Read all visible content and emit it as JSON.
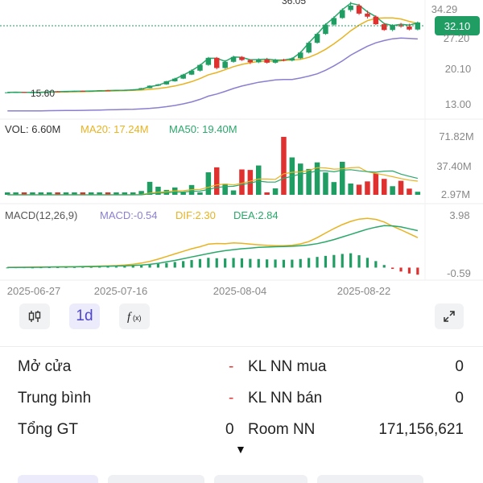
{
  "price_panel": {
    "axis_labels": [
      "34.29",
      "27.20",
      "20.10",
      "13.00"
    ],
    "current_price": "32.10",
    "low_marker": "15.60",
    "high_marker": "36.05",
    "accent_color": "#1f9d63"
  },
  "volume_panel": {
    "legend_vol": "VOL: 6.60M",
    "legend_ma20": "MA20: 17.24M",
    "legend_ma50": "MA50: 19.40M",
    "axis_labels": [
      "71.82M",
      "37.40M",
      "2.97M"
    ]
  },
  "macd_panel": {
    "legend_params": "MACD(12,26,9)",
    "legend_macd": "MACD:-0.54",
    "legend_dif": "DIF:2.30",
    "legend_dea": "DEA:2.84",
    "axis_labels": [
      "3.98",
      "-0.59"
    ]
  },
  "dates": [
    "2025-06-27",
    "2025-07-16",
    "2025-08-04",
    "2025-08-22"
  ],
  "toolbar": {
    "timeframe": "1d"
  },
  "stats": {
    "open_label": "Mở cửa",
    "open_value": "-",
    "avg_label": "Trung bình",
    "avg_value": "-",
    "total_label": "Tổng GT",
    "total_value": "0",
    "buy_label": "KL NN mua",
    "buy_value": "0",
    "sell_label": "KL NN bán",
    "sell_value": "0",
    "room_label": "Room NN",
    "room_value": "171,156,621"
  },
  "colors": {
    "up": "#1f9d63",
    "down": "#e03131",
    "ma20": "#e8b320",
    "ma50": "#2aa86a",
    "ma_long": "#8a7fd0"
  },
  "chart_data": {
    "type": "candlestick",
    "price_ylim": [
      13.0,
      34.29
    ],
    "candles": [
      [
        15.55,
        15.6,
        15.5,
        15.6
      ],
      [
        15.6,
        15.7,
        15.55,
        15.65
      ],
      [
        15.65,
        15.7,
        15.5,
        15.55
      ],
      [
        15.55,
        15.6,
        15.5,
        15.6
      ],
      [
        15.6,
        15.7,
        15.55,
        15.7
      ],
      [
        15.7,
        15.9,
        15.65,
        15.8
      ],
      [
        15.8,
        15.9,
        15.7,
        15.75
      ],
      [
        15.75,
        15.85,
        15.7,
        15.85
      ],
      [
        15.85,
        15.95,
        15.8,
        15.9
      ],
      [
        15.9,
        16.0,
        15.8,
        15.85
      ],
      [
        15.85,
        15.95,
        15.8,
        15.95
      ],
      [
        15.95,
        16.1,
        15.9,
        16.05
      ],
      [
        16.05,
        16.15,
        15.95,
        16.0
      ],
      [
        16.0,
        16.1,
        15.95,
        16.1
      ],
      [
        16.1,
        16.2,
        16.0,
        16.15
      ],
      [
        16.15,
        16.3,
        16.1,
        16.25
      ],
      [
        16.25,
        16.6,
        16.2,
        16.55
      ],
      [
        16.55,
        17.2,
        16.5,
        17.1
      ],
      [
        17.1,
        17.5,
        17.0,
        17.4
      ],
      [
        17.4,
        18.2,
        17.3,
        18.1
      ],
      [
        18.1,
        18.9,
        18.0,
        18.7
      ],
      [
        18.7,
        19.8,
        18.6,
        19.6
      ],
      [
        19.6,
        20.8,
        19.5,
        20.5
      ],
      [
        20.5,
        22.0,
        20.3,
        21.8
      ],
      [
        21.8,
        23.6,
        21.6,
        23.4
      ],
      [
        23.4,
        23.6,
        20.8,
        21.1
      ],
      [
        21.1,
        22.9,
        20.9,
        22.5
      ],
      [
        22.5,
        23.9,
        22.3,
        23.6
      ],
      [
        23.6,
        23.8,
        22.7,
        22.9
      ],
      [
        22.9,
        23.0,
        22.0,
        22.4
      ],
      [
        22.4,
        23.3,
        22.2,
        23.0
      ],
      [
        23.0,
        23.4,
        22.1,
        22.3
      ],
      [
        22.3,
        23.2,
        22.1,
        23.0
      ],
      [
        23.0,
        23.2,
        22.6,
        22.8
      ],
      [
        22.8,
        23.5,
        22.6,
        23.3
      ],
      [
        23.3,
        24.9,
        23.1,
        24.6
      ],
      [
        24.6,
        27.1,
        24.4,
        26.8
      ],
      [
        26.8,
        29.1,
        26.6,
        28.8
      ],
      [
        28.8,
        31.2,
        28.6,
        30.9
      ],
      [
        30.9,
        32.8,
        30.6,
        32.4
      ],
      [
        32.4,
        34.6,
        32.2,
        34.2
      ],
      [
        34.2,
        36.05,
        33.8,
        35.2
      ],
      [
        35.2,
        35.6,
        33.1,
        33.4
      ],
      [
        33.4,
        34.1,
        32.3,
        32.7
      ],
      [
        32.7,
        33.0,
        30.8,
        31.0
      ],
      [
        31.0,
        31.3,
        29.5,
        29.7
      ],
      [
        29.7,
        31.0,
        29.4,
        30.8
      ],
      [
        30.8,
        31.3,
        30.2,
        30.5
      ],
      [
        30.5,
        31.1,
        29.6,
        29.8
      ],
      [
        29.8,
        31.6,
        29.6,
        31.4
      ]
    ],
    "volume_ylim": [
      2.97,
      71.82
    ],
    "volume": [
      2.1,
      2.8,
      2.4,
      2.0,
      1.8,
      2.2,
      2.0,
      1.9,
      2.1,
      2.6,
      2.3,
      1.9,
      2.2,
      3.0,
      4.8,
      5.6,
      7.5,
      18.4,
      12.6,
      8.8,
      11.7,
      4.3,
      14.6,
      5.4,
      29.7,
      35.6,
      16.1,
      8.2,
      33.1,
      32.5,
      37.8,
      4.1,
      10.6,
      71.8,
      47.4,
      40.1,
      33.7,
      41.5,
      29.5,
      18.1,
      42.2,
      16.4,
      15.0,
      18.9,
      28.4,
      21.9,
      13.2,
      19.6,
      10.3,
      6.6
    ],
    "macd_ylim": [
      -0.59,
      3.98
    ],
    "macd": [
      0.01,
      0.02,
      0.02,
      0.01,
      0.02,
      0.03,
      0.03,
      0.04,
      0.04,
      0.05,
      0.05,
      0.06,
      0.07,
      0.08,
      0.1,
      0.13,
      0.17,
      0.23,
      0.29,
      0.36,
      0.43,
      0.5,
      0.58,
      0.66,
      0.75,
      0.72,
      0.7,
      0.74,
      0.71,
      0.67,
      0.66,
      0.63,
      0.62,
      0.6,
      0.61,
      0.66,
      0.74,
      0.82,
      0.9,
      0.97,
      1.05,
      1.1,
      0.95,
      0.75,
      0.5,
      0.2,
      -0.1,
      -0.3,
      -0.45,
      -0.54
    ],
    "dif": [
      0.02,
      0.03,
      0.03,
      0.04,
      0.05,
      0.05,
      0.06,
      0.07,
      0.08,
      0.09,
      0.1,
      0.12,
      0.14,
      0.16,
      0.2,
      0.26,
      0.35,
      0.48,
      0.65,
      0.85,
      1.05,
      1.25,
      1.45,
      1.6,
      1.8,
      1.85,
      1.84,
      1.9,
      1.86,
      1.8,
      1.75,
      1.71,
      1.68,
      1.68,
      1.72,
      1.82,
      2.0,
      2.3,
      2.65,
      3.0,
      3.3,
      3.55,
      3.72,
      3.78,
      3.7,
      3.5,
      3.18,
      2.9,
      2.6,
      2.3
    ],
    "dea": [
      0.01,
      0.01,
      0.02,
      0.02,
      0.03,
      0.04,
      0.05,
      0.05,
      0.06,
      0.07,
      0.08,
      0.09,
      0.1,
      0.12,
      0.14,
      0.17,
      0.2,
      0.25,
      0.33,
      0.44,
      0.55,
      0.68,
      0.82,
      0.95,
      1.08,
      1.2,
      1.3,
      1.38,
      1.45,
      1.5,
      1.55,
      1.58,
      1.6,
      1.62,
      1.64,
      1.68,
      1.74,
      1.84,
      1.98,
      2.15,
      2.35,
      2.55,
      2.75,
      2.95,
      3.1,
      3.22,
      3.2,
      3.12,
      2.98,
      2.84
    ]
  }
}
